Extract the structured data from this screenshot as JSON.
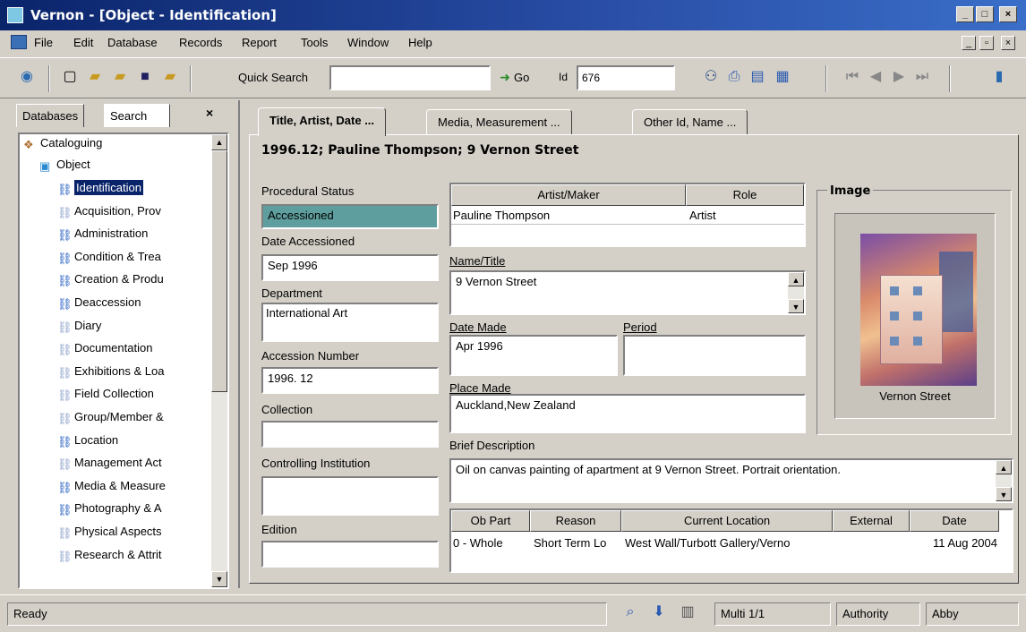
{
  "window": {
    "title": "Vernon - [Object - Identification]",
    "minimize": "_",
    "restore": "□",
    "close": "×"
  },
  "menu": {
    "items": [
      "File",
      "Edit",
      "Database",
      "Records",
      "Report",
      "Tools",
      "Window",
      "Help"
    ],
    "mdi_minimize": "_",
    "mdi_restore": "▫",
    "mdi_close": "×"
  },
  "toolbar": {
    "quick_search_label": "Quick Search",
    "quick_search_value": "",
    "go_label": "Go",
    "id_label": "Id",
    "id_value": "676",
    "icons": [
      "app-logo-icon",
      "new-document-icon",
      "open-folder-icon",
      "open-multiple-icon",
      "save-icon",
      "export-icon",
      "binoculars-icon",
      "print-preview-icon",
      "table-icon",
      "database-icon",
      "first-record-icon",
      "previous-record-icon",
      "next-record-icon",
      "last-record-icon",
      "exit-icon"
    ]
  },
  "left_panel": {
    "tabs": [
      "Databases",
      "Search"
    ],
    "close": "×",
    "root": "Cataloguing",
    "object": "Object",
    "items": [
      {
        "label": "Identification",
        "selected": true
      },
      {
        "label": "Acquisition, Prov"
      },
      {
        "label": "Administration"
      },
      {
        "label": "Condition & Trea"
      },
      {
        "label": "Creation & Produ"
      },
      {
        "label": "Deaccession"
      },
      {
        "label": "Diary"
      },
      {
        "label": "Documentation"
      },
      {
        "label": "Exhibitions & Loa"
      },
      {
        "label": "Field Collection"
      },
      {
        "label": "Group/Member &"
      },
      {
        "label": "Location"
      },
      {
        "label": "Management Act"
      },
      {
        "label": "Media & Measure"
      },
      {
        "label": "Photography & A"
      },
      {
        "label": "Physical Aspects"
      },
      {
        "label": "Research & Attrit"
      }
    ]
  },
  "tabs": [
    "Title, Artist, Date ...",
    "Media, Measurement ...",
    "Other Id, Name ..."
  ],
  "record": {
    "heading": "1996.12; Pauline Thompson; 9 Vernon Street",
    "procedural_status_label": "Procedural Status",
    "procedural_status": "Accessioned",
    "date_accessioned_label": "Date Accessioned",
    "date_accessioned": "Sep 1996",
    "department_label": "Department",
    "department": "International Art",
    "accession_number_label": "Accession Number",
    "accession_number": "1996. 12",
    "collection_label": "Collection",
    "collection": "",
    "controlling_institution_label": "Controlling Institution",
    "controlling_institution": "",
    "edition_label": "Edition",
    "edition": "",
    "artist_grid": {
      "headers": [
        "Artist/Maker",
        "Role"
      ],
      "rows": [
        [
          "Pauline Thompson",
          "Artist"
        ]
      ]
    },
    "name_title_label": "Name/Title",
    "name_title": "9 Vernon Street",
    "date_made_label": "Date Made",
    "date_made": "Apr 1996",
    "period_label": "Period",
    "period": "",
    "place_made_label": "Place Made",
    "place_made": "Auckland,New Zealand",
    "brief_description_label": "Brief Description",
    "brief_description": "Oil on canvas painting of apartment at 9 Vernon Street. Portrait orientation.",
    "image_label": "Image",
    "image_caption": "Vernon Street",
    "location_grid": {
      "headers": [
        "Ob Part",
        "Reason",
        "Current Location",
        "External",
        "Date"
      ],
      "rows": [
        [
          "0 - Whole",
          "Short Term Lo",
          "West Wall/Turbott Gallery/Verno",
          "",
          "11 Aug 2004"
        ]
      ]
    }
  },
  "statusbar": {
    "status": "Ready",
    "multi": "Multi 1/1",
    "authority": "Authority",
    "user": "Abby"
  }
}
